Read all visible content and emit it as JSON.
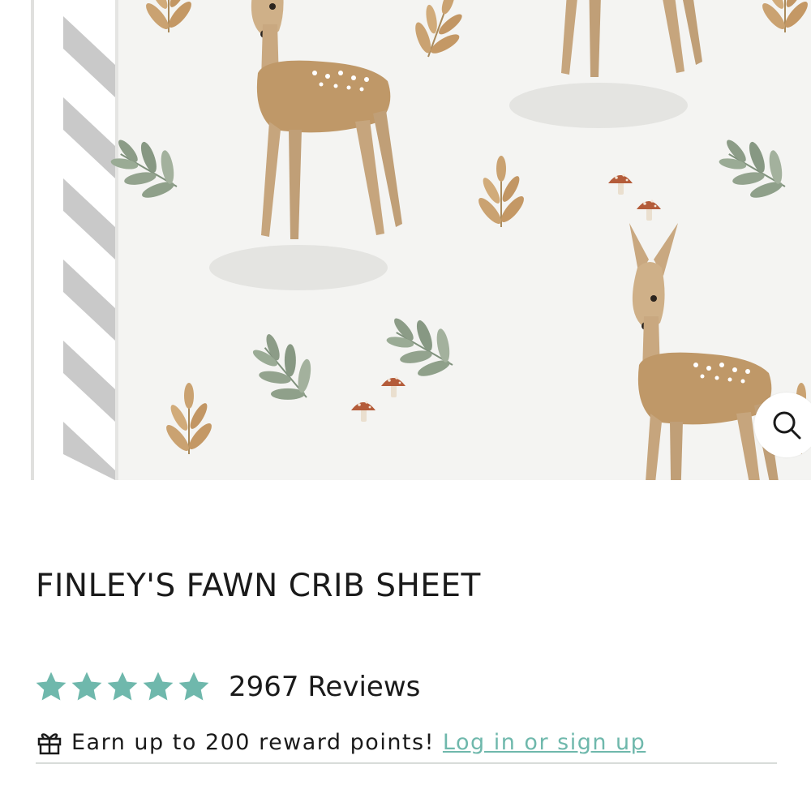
{
  "product": {
    "title": "FINLEY'S FAWN CRIB SHEET",
    "rating": 5,
    "rating_max": 5,
    "review_label": "2967 Reviews"
  },
  "rewards": {
    "text": "Earn up to 200 reward points!",
    "link_label": "Log in or sign up"
  },
  "icons": {
    "zoom": "search-icon",
    "gift": "gift-icon",
    "star": "star-icon"
  },
  "colors": {
    "star": "#6fb8ac",
    "link": "#6fb8ac",
    "text": "#1a1a1a",
    "divider": "#d8dcd9"
  }
}
